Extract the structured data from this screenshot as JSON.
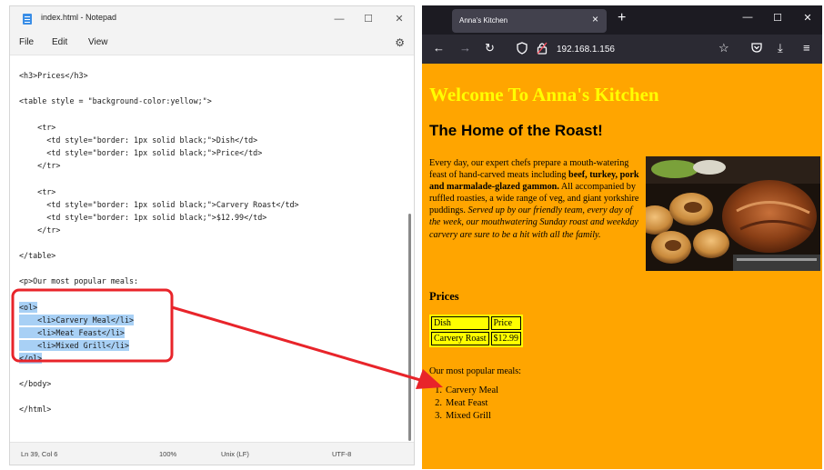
{
  "notepad": {
    "title": "index.html - Notepad",
    "menu": [
      "File",
      "Edit",
      "View"
    ],
    "code_lines": [
      "<h3>Prices</h3>",
      "",
      "<table style = \"background-color:yellow;\">",
      "",
      "    <tr>",
      "      <td style=\"border: 1px solid black;\">Dish</td>",
      "      <td style=\"border: 1px solid black;\">Price</td>",
      "    </tr>",
      "",
      "    <tr>",
      "      <td style=\"border: 1px solid black;\">Carvery Roast</td>",
      "      <td style=\"border: 1px solid black;\">$12.99</td>",
      "    </tr>",
      "",
      "</table>",
      "",
      "<p>Our most popular meals:",
      "",
      "<ol>",
      "    <li>Carvery Meal</li>",
      "    <li>Meat Feast</li>",
      "    <li>Mixed Grill</li>",
      "</ol>",
      "",
      "</body>",
      "",
      "</html>"
    ],
    "status": {
      "position": "Ln 39, Col 6",
      "zoom": "100%",
      "line_ending": "Unix (LF)",
      "encoding": "UTF-8"
    }
  },
  "browser": {
    "tab_title": "Anna's Kitchen",
    "url": "192.168.1.156",
    "page": {
      "h1": "Welcome To Anna's Kitchen",
      "h2": "The Home of the Roast!",
      "para_1": "Every day, our expert chefs prepare a mouth-watering feast of hand-carved meats including ",
      "para_bold": "beef, turkey, pork and marmalade-glazed gammon.",
      "para_2": " All accompanied by ruffled roasties, a wide range of veg, and giant yorkshire puddings. ",
      "para_italic": "Served up by our friendly team, every day of the week, our mouthwatering Sunday roast and weekday carvery are sure to be a hit with all the family.",
      "prices_heading": "Prices",
      "table": [
        [
          "Dish",
          "Price"
        ],
        [
          "Carvery Roast",
          "$12.99"
        ]
      ],
      "popular_intro": "Our most popular meals:",
      "meals": [
        "Carvery Meal",
        "Meat Feast",
        "Mixed Grill"
      ]
    }
  },
  "colors": {
    "page_background": "#ffa500",
    "heading_yellow": "#ffff00",
    "selection": "#a8d0f5",
    "annotation_red": "#e8242a"
  }
}
